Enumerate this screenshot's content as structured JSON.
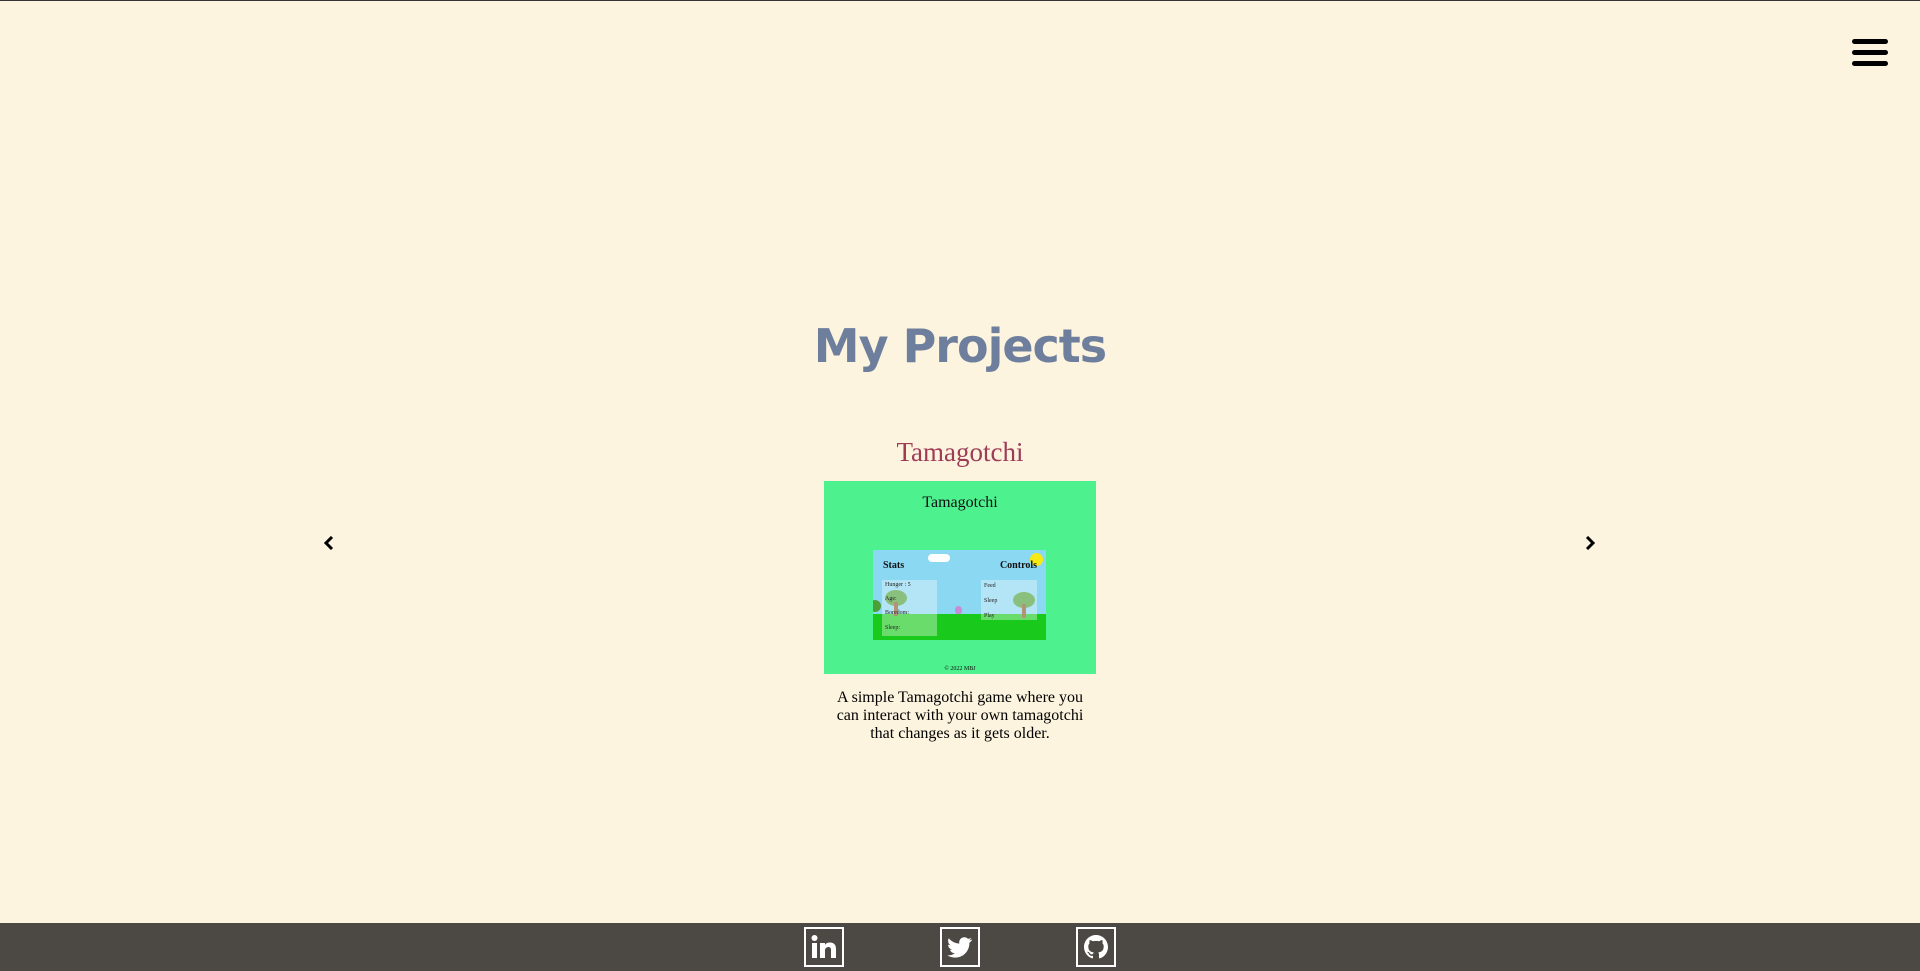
{
  "header": {
    "menu_icon": "hamburger-menu-icon"
  },
  "page": {
    "title": "My Projects"
  },
  "carousel": {
    "prev_icon": "chevron-left-icon",
    "next_icon": "chevron-right-icon",
    "current": {
      "title": "Tamagotchi",
      "screenshot": {
        "title": "Tamagotchi",
        "stats_label": "Stats",
        "controls_label": "Controls",
        "stats": [
          "Hunger : 5",
          "Age:",
          "Boredom:",
          "Sleep:"
        ],
        "controls": [
          "Feed",
          "Sleep",
          "Play"
        ],
        "footer": "© 2022 MBJ"
      },
      "description": "A simple Tamagotchi game where you can interact with your own tamagotchi that changes as it gets older."
    }
  },
  "footer": {
    "links": [
      {
        "icon": "linkedin-icon"
      },
      {
        "icon": "twitter-icon"
      },
      {
        "icon": "github-icon"
      }
    ]
  },
  "colors": {
    "background": "#fdf4df",
    "title": "#6e7f9e",
    "project_title": "#9e3b57",
    "footer": "#4c4944",
    "screenshot_bg": "#4df28f"
  }
}
